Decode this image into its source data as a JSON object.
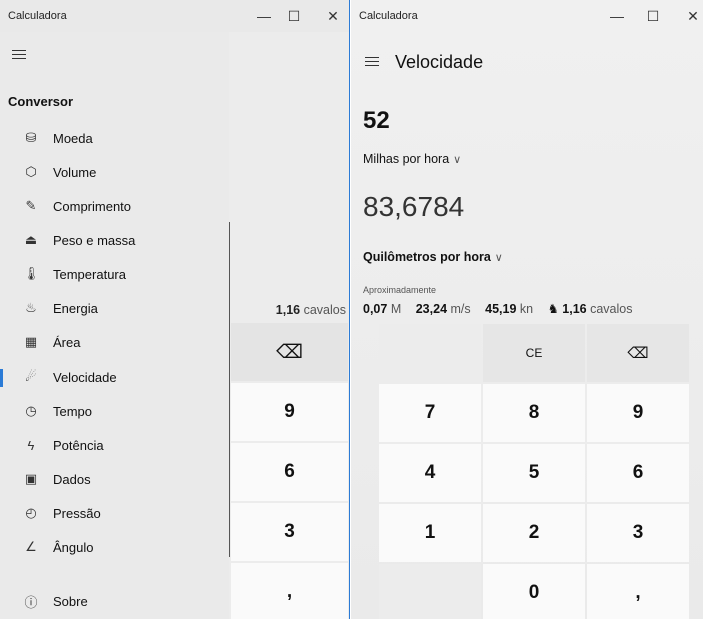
{
  "left_window": {
    "title": "Calculadora",
    "controls": {
      "minimize": "—",
      "maximize": "☐",
      "close": "✕"
    },
    "nav": {
      "header": "Conversor",
      "items": [
        {
          "label": "Moeda",
          "icon": "currency-icon",
          "glyph": "⛁"
        },
        {
          "label": "Volume",
          "icon": "cube-icon",
          "glyph": "⬡"
        },
        {
          "label": "Comprimento",
          "icon": "ruler-icon",
          "glyph": "✎"
        },
        {
          "label": "Peso e massa",
          "icon": "weight-icon",
          "glyph": "⏏"
        },
        {
          "label": "Temperatura",
          "icon": "thermometer-icon",
          "glyph": "🌡"
        },
        {
          "label": "Energia",
          "icon": "fire-icon",
          "glyph": "♨"
        },
        {
          "label": "Área",
          "icon": "grid-icon",
          "glyph": "▦"
        },
        {
          "label": "Velocidade",
          "icon": "speed-icon",
          "glyph": "☄",
          "selected": true
        },
        {
          "label": "Tempo",
          "icon": "clock-icon",
          "glyph": "◷"
        },
        {
          "label": "Potência",
          "icon": "lightning-icon",
          "glyph": "ϟ"
        },
        {
          "label": "Dados",
          "icon": "data-icon",
          "glyph": "▣"
        },
        {
          "label": "Pressão",
          "icon": "gauge-icon",
          "glyph": "◴"
        },
        {
          "label": "Ângulo",
          "icon": "angle-icon",
          "glyph": "∠"
        }
      ],
      "about": {
        "label": "Sobre",
        "icon": "info-icon",
        "glyph": "ⓘ"
      }
    },
    "behind": {
      "hist_value": "1,16",
      "hist_unit": "cavalos",
      "keys": [
        "⌫",
        "9",
        "6",
        "3",
        ","
      ]
    }
  },
  "right_window": {
    "title": "Calculadora",
    "controls": {
      "minimize": "—",
      "maximize": "☐",
      "close": "✕"
    },
    "mode": "Velocidade",
    "from_value": "52",
    "from_unit": "Milhas por hora",
    "to_value": "83,6784",
    "to_unit": "Quilômetros por hora",
    "chevron": "∨",
    "approx_label": "Aproximadamente",
    "approx": [
      {
        "value": "0,07",
        "unit": "M"
      },
      {
        "value": "23,24",
        "unit": "m/s"
      },
      {
        "value": "45,19",
        "unit": "kn"
      },
      {
        "value": "1,16",
        "unit": "cavalos",
        "icon": "horse-icon",
        "glyph": "♞"
      }
    ],
    "keys": {
      "ce": "CE",
      "backspace": "⌫",
      "k7": "7",
      "k8": "8",
      "k9": "9",
      "k4": "4",
      "k5": "5",
      "k6": "6",
      "k1": "1",
      "k2": "2",
      "k3": "3",
      "k0": "0",
      "comma": ","
    }
  }
}
